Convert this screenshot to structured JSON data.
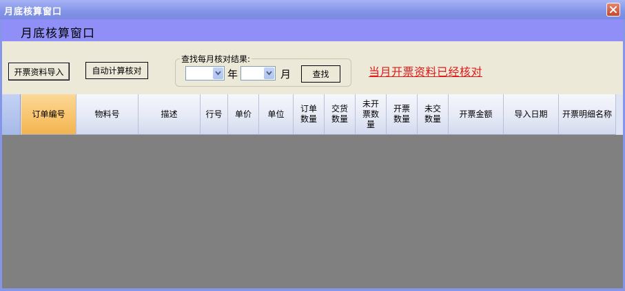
{
  "window": {
    "title": "月底核算窗口",
    "header_title": "月底核算窗口"
  },
  "toolbar": {
    "import_label": "开票资料导入",
    "auto_calc_label": "自动计算核对",
    "query": {
      "label": "查找每月核对结果:",
      "year_value": "",
      "year_unit": "年",
      "month_value": "",
      "month_unit": "月",
      "find_label": "查找"
    },
    "status_text": "当月开票资料已经核对"
  },
  "grid": {
    "columns": [
      "订单编号",
      "物料号",
      "描述",
      "行号",
      "单价",
      "单位",
      "订单数量",
      "交货数量",
      "未开票数量",
      "开票数量",
      "未交数量",
      "开票金额",
      "导入日期",
      "开票明细名称"
    ],
    "active_column": "订单编号",
    "rows": []
  },
  "colors": {
    "window_frame": "#8595e8",
    "header_band": "#8f8ff7",
    "toolbar_bg": "#ece9d8",
    "grid_bg": "#808080",
    "status_text": "#e01818",
    "active_column": "#f8c56e"
  },
  "icons": {
    "close": "close-icon",
    "dropdown": "chevron-down-icon"
  }
}
